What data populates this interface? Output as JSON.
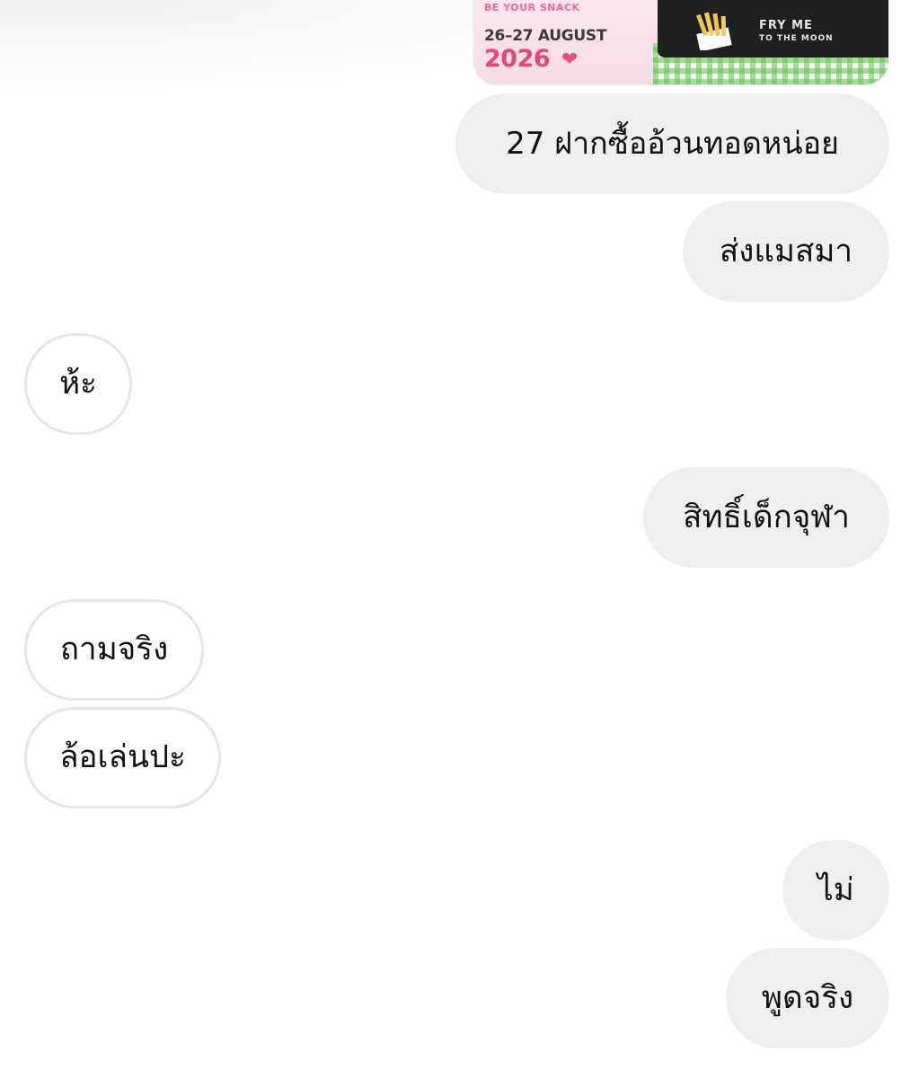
{
  "attachment": {
    "tag": "BE YOUR SNACK",
    "date": "26–27 AUGUST",
    "year": "2026",
    "slogan_line1": "FRY ME",
    "slogan_line2": "TO THE MOON",
    "heart": "❤"
  },
  "messages": [
    {
      "side": "sent",
      "text": "27 ฝากซื้ออ้วนทอดหน่อย"
    },
    {
      "side": "sent",
      "text": "ส่งแมสมา"
    },
    {
      "side": "received",
      "text": "ห้ะ"
    },
    {
      "side": "sent",
      "text": "สิทธิ์เด็กจุฬา"
    },
    {
      "side": "received",
      "text": "ถามจริง"
    },
    {
      "side": "received",
      "text": "ล้อเล่นปะ"
    },
    {
      "side": "sent",
      "text": "ไม่"
    },
    {
      "side": "sent",
      "text": "พูดจริง"
    }
  ],
  "colors": {
    "sent_bubble": "#efefef",
    "received_border": "#e6e6e6",
    "text": "#111111"
  }
}
